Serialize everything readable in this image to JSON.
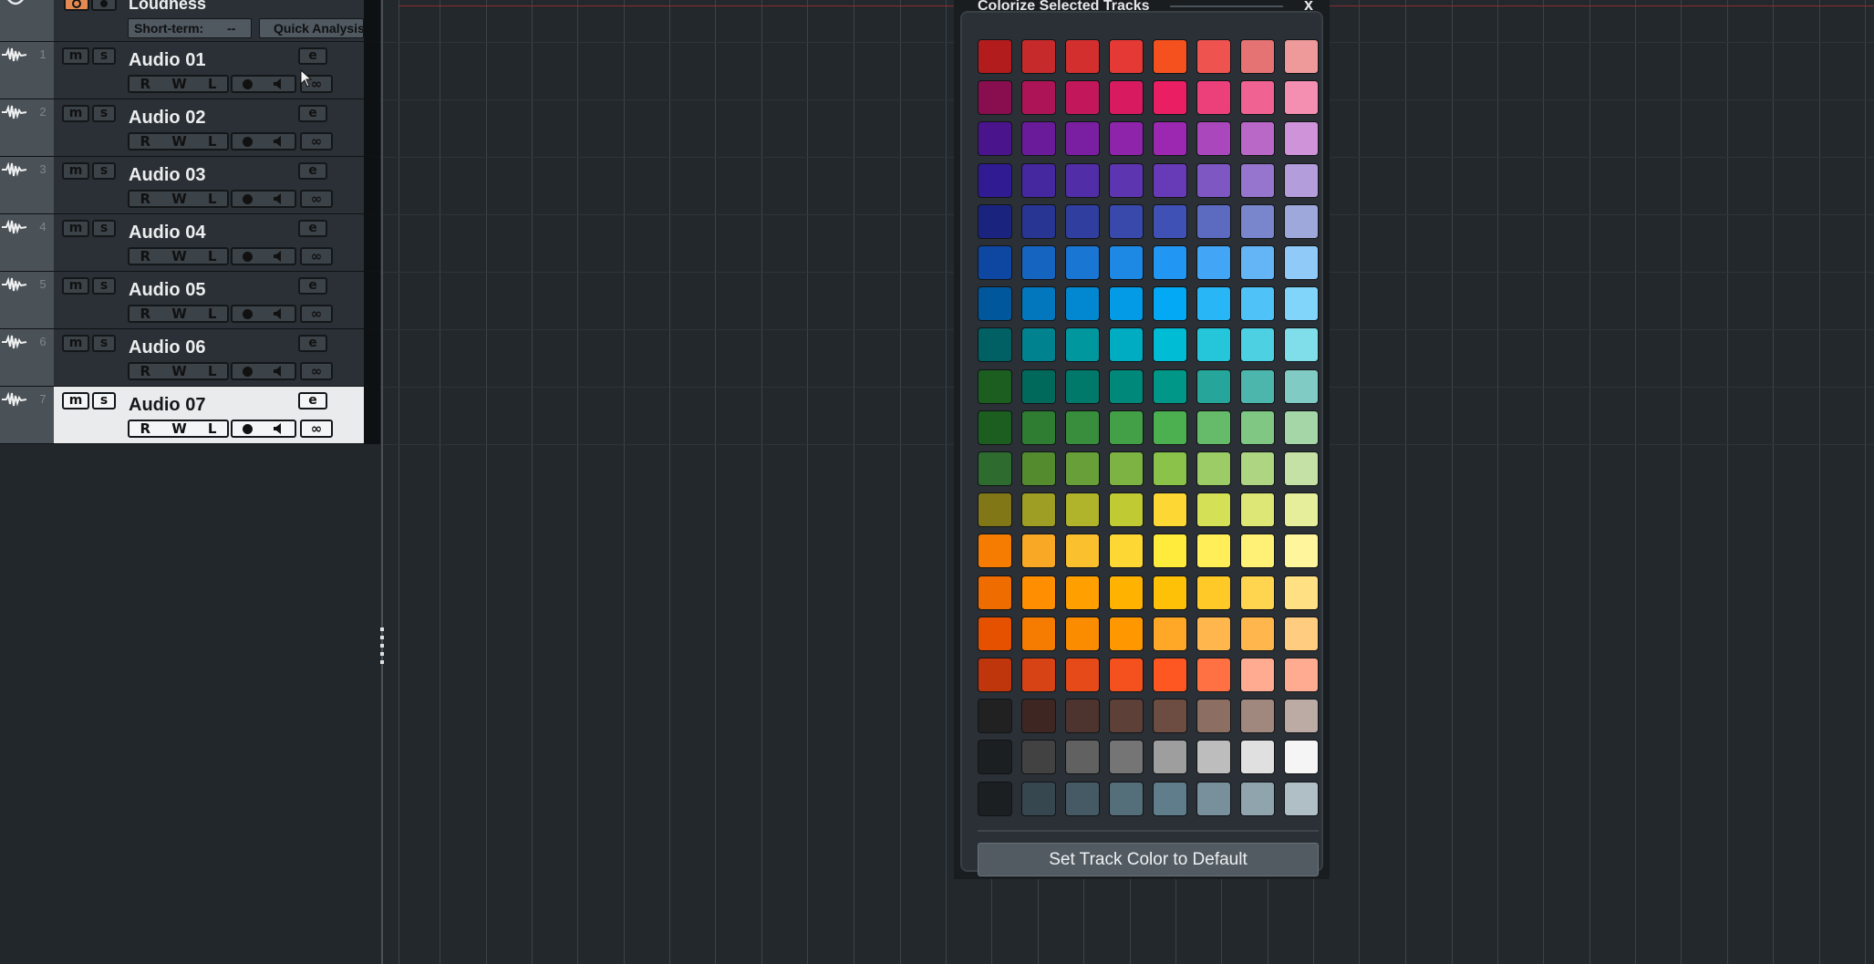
{
  "loudness": {
    "title": "Loudness",
    "short_term_label": "Short-term:",
    "short_term_value": "--",
    "quick_analysis_label": "Quick Analysis"
  },
  "tracks": [
    {
      "num": "1",
      "name": "Audio 01"
    },
    {
      "num": "2",
      "name": "Audio 02"
    },
    {
      "num": "3",
      "name": "Audio 03"
    },
    {
      "num": "4",
      "name": "Audio 04"
    },
    {
      "num": "5",
      "name": "Audio 05"
    },
    {
      "num": "6",
      "name": "Audio 06"
    },
    {
      "num": "7",
      "name": "Audio 07"
    }
  ],
  "track_buttons": {
    "mute": "m",
    "solo": "s",
    "read": "R",
    "write": "W",
    "lanes": "L",
    "edit": "e",
    "link": "∞"
  },
  "colorize": {
    "title": "Colorize Selected Tracks",
    "close": "x",
    "default_button": "Set Track Color to Default",
    "swatches": [
      [
        "#b31c1c",
        "#c62a2a",
        "#d32f2f",
        "#e53935",
        "#f4511e",
        "#ef5350",
        "#e57373",
        "#ef9a9a"
      ],
      [
        "#880e4f",
        "#ad1457",
        "#c2185b",
        "#d81b60",
        "#e91e63",
        "#ec407a",
        "#f06292",
        "#f48fb1"
      ],
      [
        "#4a148c",
        "#6a1b9a",
        "#7b1fa2",
        "#8e24aa",
        "#9c27b0",
        "#ab47bc",
        "#ba68c8",
        "#ce93d8"
      ],
      [
        "#311b92",
        "#4527a0",
        "#512da8",
        "#5e35b1",
        "#673ab7",
        "#7e57c2",
        "#9575cd",
        "#b39ddb"
      ],
      [
        "#1a237e",
        "#283593",
        "#303f9f",
        "#3949ab",
        "#3f51b5",
        "#5c6bc0",
        "#7986cb",
        "#9fa8da"
      ],
      [
        "#0d47a1",
        "#1565c0",
        "#1976d2",
        "#1e88e5",
        "#2196f3",
        "#42a5f5",
        "#64b5f6",
        "#90caf9"
      ],
      [
        "#01579b",
        "#0277bd",
        "#0288d1",
        "#039be5",
        "#03a9f4",
        "#29b6f6",
        "#4fc3f7",
        "#81d4fa"
      ],
      [
        "#006064",
        "#00838f",
        "#00979f",
        "#00acc1",
        "#00bcd4",
        "#26c6da",
        "#4dd0e1",
        "#80deea"
      ],
      [
        "#1b5e20",
        "#00695c",
        "#00796b",
        "#00897b",
        "#009688",
        "#26a69a",
        "#4db6ac",
        "#80cbc4"
      ],
      [
        "#1b5e20",
        "#2e7d32",
        "#388e3c",
        "#43a047",
        "#4caf50",
        "#66bb6a",
        "#81c784",
        "#a5d6a7"
      ],
      [
        "#2e6b2e",
        "#558b2f",
        "#689f38",
        "#7cb342",
        "#8bc34a",
        "#9ccc65",
        "#aed581",
        "#c5e1a5"
      ],
      [
        "#827717",
        "#9e9d24",
        "#afb42b",
        "#c0ca33",
        "#fdd835",
        "#d4e157",
        "#dce775",
        "#e6ee9c"
      ],
      [
        "#f57c00",
        "#f9a825",
        "#fbc02d",
        "#fdd835",
        "#ffeb3b",
        "#ffee58",
        "#fff176",
        "#fff59d"
      ],
      [
        "#ef6c00",
        "#ff8f00",
        "#ffa000",
        "#ffb300",
        "#ffc107",
        "#ffca28",
        "#ffd54f",
        "#ffe082"
      ],
      [
        "#e65100",
        "#f57c00",
        "#fb8c00",
        "#ff9800",
        "#ffa726",
        "#ffb74d",
        "#ffb74d",
        "#ffcc80"
      ],
      [
        "#bf360c",
        "#d84315",
        "#e64a19",
        "#f4511e",
        "#ff5722",
        "#ff7043",
        "#ffab91",
        "#ffab91"
      ],
      [
        "#212121",
        "#3e2723",
        "#4e342e",
        "#5d4037",
        "#6d4c41",
        "#8d6e63",
        "#a1887f",
        "#bcaaa4"
      ],
      [
        "#1c1f22",
        "#424242",
        "#616161",
        "#757575",
        "#9e9e9e",
        "#bdbdbd",
        "#e0e0e0",
        "#f5f5f5"
      ],
      [
        "#1c1f22",
        "#37474f",
        "#455a64",
        "#546e7a",
        "#607d8b",
        "#78909c",
        "#90a4ae",
        "#b0bec5"
      ]
    ]
  }
}
